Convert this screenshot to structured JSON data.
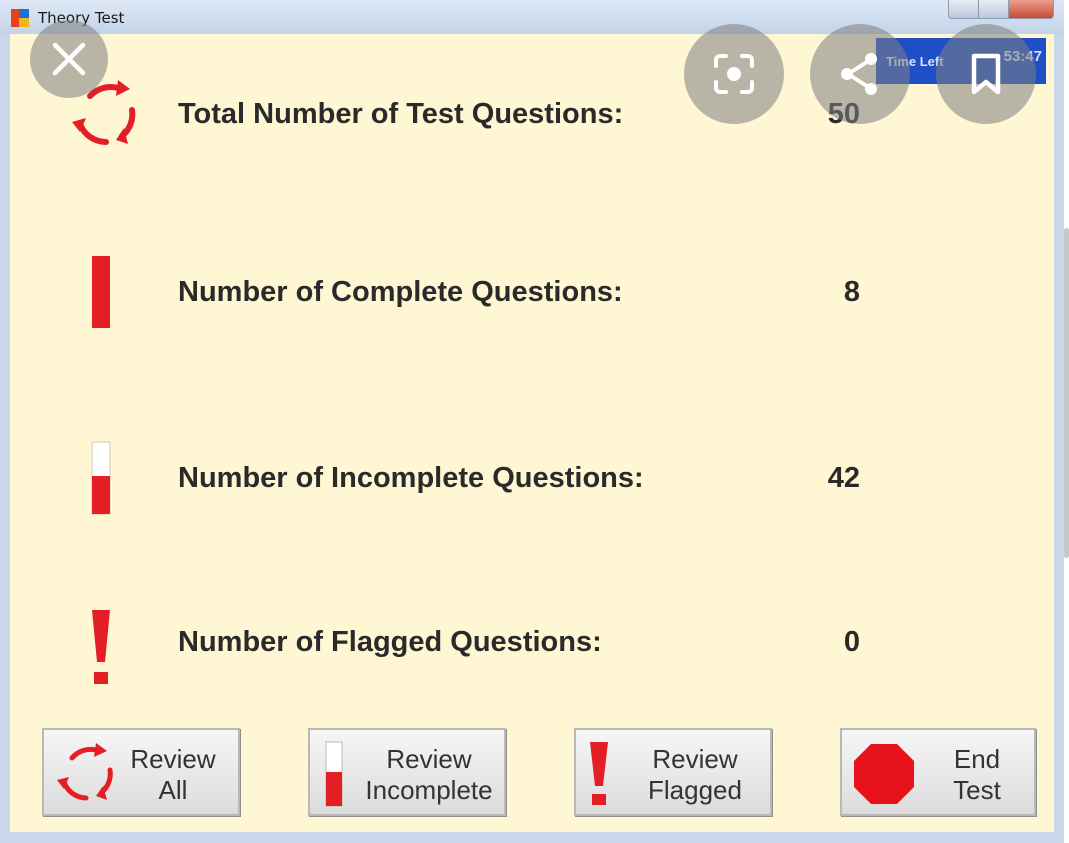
{
  "window": {
    "title": "Theory Test"
  },
  "timer": {
    "label": "Time Left",
    "value": "53:47"
  },
  "stats": [
    {
      "label": "Total Number of Test Questions:",
      "value": "50",
      "icon": "rotate-arrows-icon"
    },
    {
      "label": "Number of Complete Questions:",
      "value": "8",
      "icon": "full-bar-icon"
    },
    {
      "label": "Number of Incomplete Questions:",
      "value": "42",
      "icon": "partial-bar-icon"
    },
    {
      "label": "Number of Flagged Questions:",
      "value": "0",
      "icon": "exclamation-icon"
    }
  ],
  "buttons": {
    "review_all": {
      "line1": "Review",
      "line2": "All"
    },
    "review_incomplete": {
      "line1": "Review",
      "line2": "Incomplete"
    },
    "review_flagged": {
      "line1": "Review",
      "line2": "Flagged"
    },
    "end_test": {
      "line1": "End",
      "line2": "Test"
    }
  },
  "overlay_icons": [
    "close-icon",
    "lens-icon",
    "share-icon",
    "bookmark-icon"
  ],
  "colors": {
    "background": "#fff7d4",
    "icon_red": "#e31e24",
    "timer_blue": "#1e4fc6",
    "stop_red": "#e8121c"
  }
}
